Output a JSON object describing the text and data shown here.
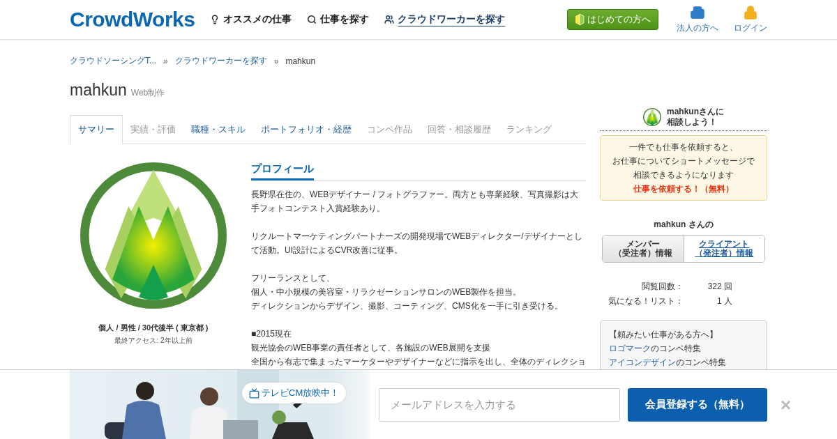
{
  "header": {
    "logo": "CrowdWorks",
    "nav": [
      {
        "label": "オススメの仕事",
        "selected": false
      },
      {
        "label": "仕事を探す",
        "selected": false
      },
      {
        "label": "クラウドワーカーを探す",
        "selected": true
      }
    ],
    "beginner_button": "はじめての方へ",
    "links": [
      {
        "label": "法人の方へ"
      },
      {
        "label": "ログイン"
      }
    ]
  },
  "breadcrumb": {
    "separator": "»",
    "items": [
      {
        "label": "クラウドソーシングT...",
        "link": true
      },
      {
        "label": "クラウドワーカーを探す",
        "link": true
      },
      {
        "label": "mahkun",
        "link": false
      }
    ]
  },
  "profile": {
    "name": "mahkun",
    "category": "Web制作",
    "tabs": [
      {
        "label": "サマリー",
        "selected": true,
        "disabled": false
      },
      {
        "label": "実績・評価",
        "selected": false,
        "disabled": true
      },
      {
        "label": "職種・スキル",
        "selected": false,
        "disabled": false
      },
      {
        "label": "ポートフォリオ・経歴",
        "selected": false,
        "disabled": false
      },
      {
        "label": "コンペ作品",
        "selected": false,
        "disabled": true
      },
      {
        "label": "回答・相談履歴",
        "selected": false,
        "disabled": true
      },
      {
        "label": "ランキング",
        "selected": false,
        "disabled": true
      }
    ],
    "attributes": "個人 / 男性 / 30代後半 ( 東京都 )",
    "last_access": "最終アクセス: 2年以上前",
    "section_title": "プロフィール",
    "paragraphs": [
      [
        "長野県在住の、WEBデザイナー / フォトグラファー。両方とも専業経験、写真撮影は大手フォトコンテスト入賞経験あり。"
      ],
      [
        "リクルートマーケティングパートナーズの開発現場でWEBディレクター/デザイナーとして活動。UI設計によるCVR改善に従事。"
      ],
      [
        "フリーランスとして、",
        "個人・中小規模の美容室・リラクゼーションサロンのWEB製作を担当。",
        "ディレクションからデザイン、撮影、コーティング、CMS化を一手に引き受ける。"
      ],
      [
        "■2015現在",
        "観光協会のWEB事業の責任者として、各施設のWEB展開を支援",
        "全国から有志で集まったマーケターやデザイナーなどに指示を出し、全体のディレクショ"
      ]
    ]
  },
  "sidebar": {
    "consult_title": [
      "mahkunさんに",
      "相談しよう！"
    ],
    "notice": [
      "一件でも仕事を依頼すると、",
      "お仕事についてショートメッセージで",
      "相談できるようになります"
    ],
    "request_link": "仕事を依頼する！（無料）",
    "info_title": "mahkun さんの",
    "info_tabs": [
      {
        "lines": [
          "メンバー",
          "（受注者）情報"
        ],
        "selected": true
      },
      {
        "lines": [
          "クライアント",
          "（発注者）情報"
        ],
        "selected": false
      }
    ],
    "stats": [
      {
        "label": "閲覧回数：",
        "value": "322 回"
      },
      {
        "label": "気になる！リスト：",
        "value": "1 人"
      }
    ],
    "features_title": "【頼みたい仕事がある方へ】",
    "features": [
      {
        "link": "ロゴマーク",
        "rest": "のコンペ特集"
      },
      {
        "link": "アイコンデザイン",
        "rest": "のコンペ特集"
      }
    ]
  },
  "signup_bar": {
    "badge": "テレビCM放映中！",
    "email_placeholder": "メールアドレスを入力する",
    "button": "会員登録する（無料）",
    "close": "×"
  }
}
